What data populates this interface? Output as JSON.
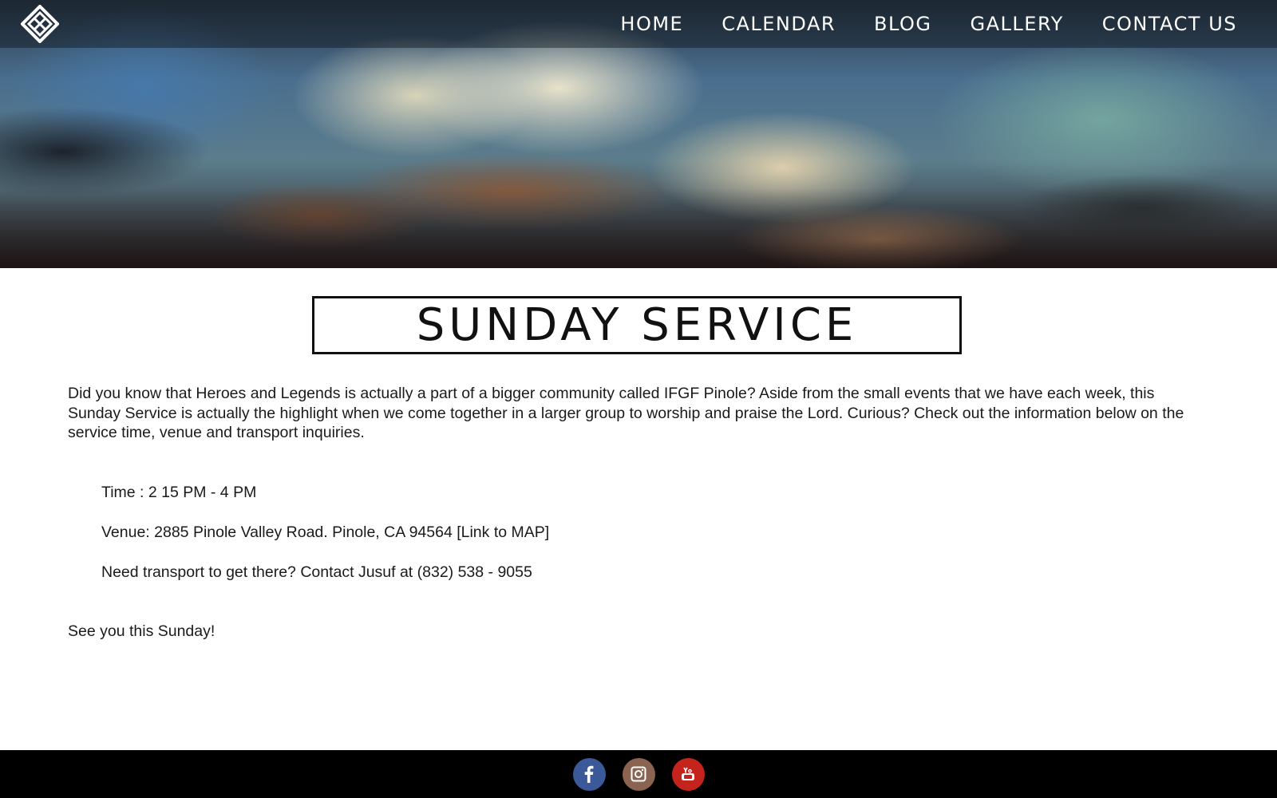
{
  "nav": {
    "logo_icon": "hl-diamond-logo-icon",
    "items": [
      {
        "label": "HOME"
      },
      {
        "label": "CALENDAR"
      },
      {
        "label": "BLOG"
      },
      {
        "label": "GALLERY"
      },
      {
        "label": "CONTACT US"
      }
    ]
  },
  "hero": {
    "image": "stormy-cloud-sky"
  },
  "main": {
    "title": "SUNDAY SERVICE",
    "intro": "Did you know that Heroes and Legends is actually a part of a bigger community called IFGF Pinole? Aside from the small events that we have each week, this Sunday Service is actually the highlight when we come together in a larger group to worship and praise the Lord. Curious? Check out the information below on the service time, venue and transport inquiries.",
    "details": [
      {
        "text": "Time : 2 15 PM - 4 PM"
      },
      {
        "text": "Venue: 2885 Pinole Valley Road. Pinole, CA 94564 [Link to MAP]"
      },
      {
        "text": "Need transport to get there? Contact Jusuf at (832) 538 - 9055"
      }
    ],
    "outro": "See you this Sunday!"
  },
  "footer": {
    "social": [
      {
        "icon": "facebook-icon",
        "color": "#3b5998"
      },
      {
        "icon": "instagram-icon",
        "color": "#8a6450"
      },
      {
        "icon": "youtube-icon",
        "color": "#c4241c"
      }
    ]
  },
  "colors": {
    "text": "#1a1a1a",
    "footer_bg": "#000000",
    "title_border": "#111111"
  }
}
